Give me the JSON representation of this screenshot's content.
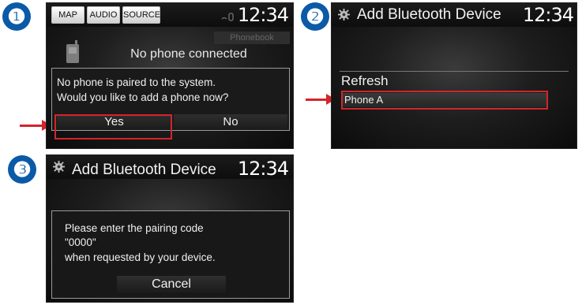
{
  "steps": [
    "❶",
    "❷",
    "❸"
  ],
  "screen1": {
    "tabs": [
      "MAP",
      "AUDIO",
      "SOURCE"
    ],
    "signal_icon": "bluetooth-signal-icon",
    "time": "12:34",
    "phonebook_label": "Phonebook",
    "status": "No phone connected",
    "dialog_line1": "No phone is paired to the system.",
    "dialog_line2": "Would you like to add a phone now?",
    "yes_label": "Yes",
    "no_label": "No"
  },
  "screen2": {
    "title": "Add Bluetooth Device",
    "time": "12:34",
    "refresh_label": "Refresh",
    "device_label": "Phone A"
  },
  "screen3": {
    "title": "Add Bluetooth Device",
    "time": "12:34",
    "line1": "Please enter the pairing code",
    "line2": "\"0000\"",
    "line3": "when requested by your device.",
    "cancel_label": "Cancel"
  },
  "colors": {
    "accent_blue": "#0a5aa8",
    "highlight_red": "#d3252a"
  }
}
